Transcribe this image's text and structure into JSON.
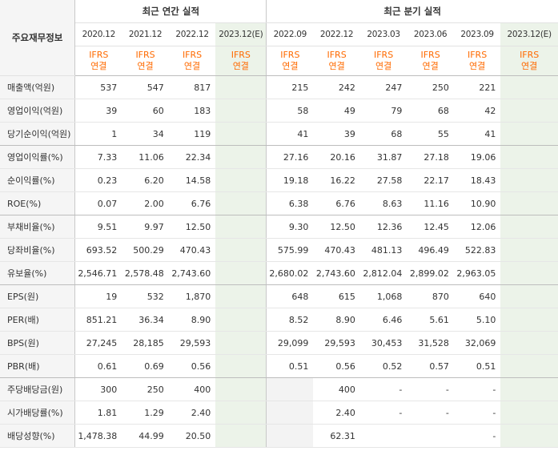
{
  "header": {
    "row_label": "주요재무정보",
    "annual_title": "최근 연간 실적",
    "quarterly_title": "최근 분기 실적",
    "annual_periods": [
      "2020.12",
      "2021.12",
      "2022.12",
      "2023.12(E)"
    ],
    "quarterly_periods": [
      "2022.09",
      "2022.12",
      "2023.03",
      "2023.06",
      "2023.09",
      "2023.12(E)"
    ],
    "ifrs_line1": "IFRS",
    "ifrs_line2": "연결"
  },
  "rows": [
    {
      "label": "매출액(억원)",
      "values": [
        "537",
        "547",
        "817",
        "",
        "215",
        "242",
        "247",
        "250",
        "221",
        ""
      ]
    },
    {
      "label": "영업이익(억원)",
      "values": [
        "39",
        "60",
        "183",
        "",
        "58",
        "49",
        "79",
        "68",
        "42",
        ""
      ]
    },
    {
      "label": "당기순이익(억원)",
      "values": [
        "1",
        "34",
        "119",
        "",
        "41",
        "39",
        "68",
        "55",
        "41",
        ""
      ]
    },
    {
      "label": "영업이익률(%)",
      "values": [
        "7.33",
        "11.06",
        "22.34",
        "",
        "27.16",
        "20.16",
        "31.87",
        "27.18",
        "19.06",
        ""
      ]
    },
    {
      "label": "순이익률(%)",
      "values": [
        "0.23",
        "6.20",
        "14.58",
        "",
        "19.18",
        "16.22",
        "27.58",
        "22.17",
        "18.43",
        ""
      ]
    },
    {
      "label": "ROE(%)",
      "values": [
        "0.07",
        "2.00",
        "6.76",
        "",
        "6.38",
        "6.76",
        "8.63",
        "11.16",
        "10.90",
        ""
      ]
    },
    {
      "label": "부채비율(%)",
      "values": [
        "9.51",
        "9.97",
        "12.50",
        "",
        "9.30",
        "12.50",
        "12.36",
        "12.45",
        "12.06",
        ""
      ]
    },
    {
      "label": "당좌비율(%)",
      "values": [
        "693.52",
        "500.29",
        "470.43",
        "",
        "575.99",
        "470.43",
        "481.13",
        "496.49",
        "522.83",
        ""
      ]
    },
    {
      "label": "유보율(%)",
      "values": [
        "2,546.71",
        "2,578.48",
        "2,743.60",
        "",
        "2,680.02",
        "2,743.60",
        "2,812.04",
        "2,899.02",
        "2,963.05",
        ""
      ]
    },
    {
      "label": "EPS(원)",
      "values": [
        "19",
        "532",
        "1,870",
        "",
        "648",
        "615",
        "1,068",
        "870",
        "640",
        ""
      ]
    },
    {
      "label": "PER(배)",
      "values": [
        "851.21",
        "36.34",
        "8.90",
        "",
        "8.52",
        "8.90",
        "6.46",
        "5.61",
        "5.10",
        ""
      ]
    },
    {
      "label": "BPS(원)",
      "values": [
        "27,245",
        "28,185",
        "29,593",
        "",
        "29,099",
        "29,593",
        "30,453",
        "31,528",
        "32,069",
        ""
      ]
    },
    {
      "label": "PBR(배)",
      "values": [
        "0.61",
        "0.69",
        "0.56",
        "",
        "0.51",
        "0.56",
        "0.52",
        "0.57",
        "0.51",
        ""
      ]
    },
    {
      "label": "주당배당금(원)",
      "values": [
        "300",
        "250",
        "400",
        "",
        "",
        "400",
        "-",
        "-",
        "-",
        ""
      ]
    },
    {
      "label": "시가배당률(%)",
      "values": [
        "1.81",
        "1.29",
        "2.40",
        "",
        "",
        "2.40",
        "-",
        "-",
        "-",
        ""
      ]
    },
    {
      "label": "배당성향(%)",
      "values": [
        "1,478.38",
        "44.99",
        "20.50",
        "",
        "",
        "62.31",
        "",
        "",
        "-",
        ""
      ]
    }
  ],
  "colors": {
    "estimate_bg": "#ecf3e9",
    "label_bg": "#f5f5f5",
    "ifrs_text": "#ff6a00",
    "blank_bg": "#f3f3f3"
  }
}
